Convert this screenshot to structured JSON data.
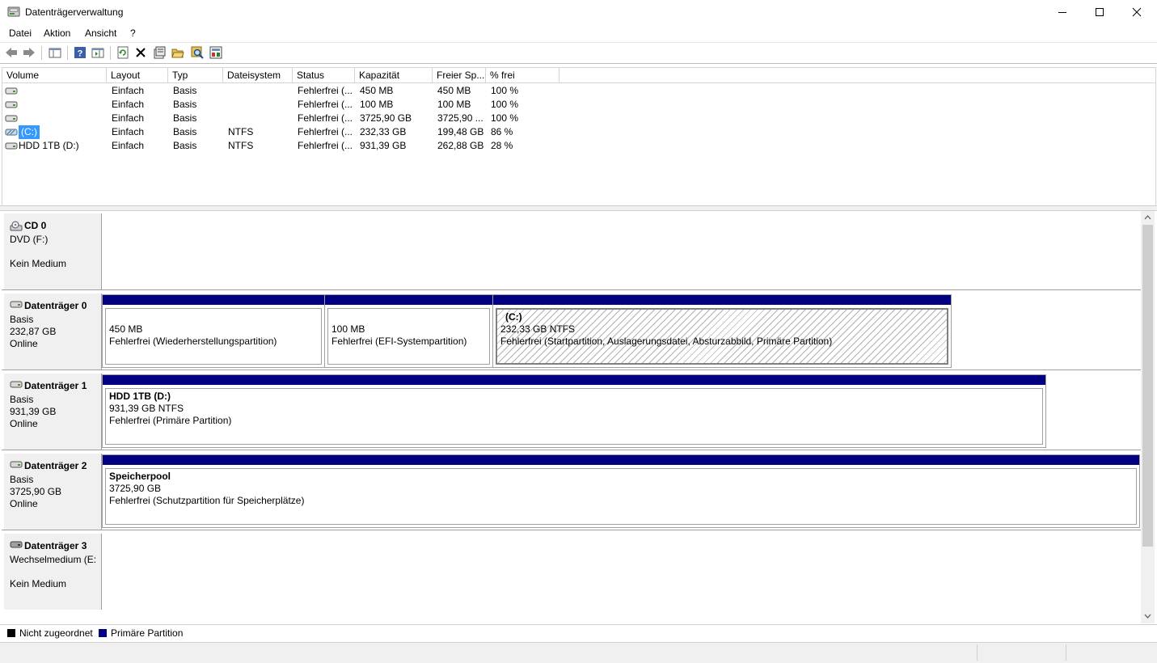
{
  "window": {
    "title": "Datenträgerverwaltung",
    "minimize_glyph": "—",
    "maximize_glyph": "☐",
    "close_glyph": "✕"
  },
  "menu": [
    "Datei",
    "Aktion",
    "Ansicht",
    "?"
  ],
  "toolbar": [
    "back-icon",
    "forward-icon",
    "show-hide-tree-icon",
    "help-icon",
    "show-hide-action-pane-icon",
    "refresh-icon",
    "delete-icon",
    "properties-icon",
    "open-icon",
    "explore-icon",
    "settings-icon"
  ],
  "volume_list": {
    "columns": [
      "Volume",
      "Layout",
      "Typ",
      "Dateisystem",
      "Status",
      "Kapazität",
      "Freier Sp...",
      "% frei"
    ],
    "rows": [
      {
        "volume": "",
        "layout": "Einfach",
        "typ": "Basis",
        "fs": "",
        "status": "Fehlerfrei (...",
        "cap": "450 MB",
        "free": "450 MB",
        "pct": "100 %"
      },
      {
        "volume": "",
        "layout": "Einfach",
        "typ": "Basis",
        "fs": "",
        "status": "Fehlerfrei (...",
        "cap": "100 MB",
        "free": "100 MB",
        "pct": "100 %"
      },
      {
        "volume": "",
        "layout": "Einfach",
        "typ": "Basis",
        "fs": "",
        "status": "Fehlerfrei (...",
        "cap": "3725,90 GB",
        "free": "3725,90 ...",
        "pct": "100 %"
      },
      {
        "volume": "(C:)",
        "layout": "Einfach",
        "typ": "Basis",
        "fs": "NTFS",
        "status": "Fehlerfrei (...",
        "cap": "232,33 GB",
        "free": "199,48 GB",
        "pct": "86 %"
      },
      {
        "volume": "HDD 1TB (D:)",
        "layout": "Einfach",
        "typ": "Basis",
        "fs": "NTFS",
        "status": "Fehlerfrei (...",
        "cap": "931,39 GB",
        "free": "262,88 GB",
        "pct": "28 %"
      }
    ]
  },
  "disks": {
    "cd0": {
      "name": "CD 0",
      "l1": "DVD (F:)",
      "l2": "",
      "l3": "Kein Medium"
    },
    "disk0": {
      "name": "Datenträger 0",
      "l1": "Basis",
      "l2": "232,87 GB",
      "l3": "Online",
      "parts": [
        {
          "name": "",
          "size": "450 MB",
          "status": "Fehlerfrei (Wiederherstellungspartition)"
        },
        {
          "name": "",
          "size": "100 MB",
          "status": "Fehlerfrei (EFI-Systempartition)"
        },
        {
          "name": "(C:)",
          "size": "232,33 GB NTFS",
          "status": "Fehlerfrei (Startpartition, Auslagerungsdatei, Absturzabbild, Primäre Partition)"
        }
      ]
    },
    "disk1": {
      "name": "Datenträger 1",
      "l1": "Basis",
      "l2": "931,39 GB",
      "l3": "Online",
      "parts": [
        {
          "name": "HDD 1TB  (D:)",
          "size": "931,39 GB NTFS",
          "status": "Fehlerfrei (Primäre Partition)"
        }
      ]
    },
    "disk2": {
      "name": "Datenträger 2",
      "l1": "Basis",
      "l2": "3725,90 GB",
      "l3": "Online",
      "parts": [
        {
          "name": "Speicherpool",
          "size": "3725,90 GB",
          "status": "Fehlerfrei (Schutzpartition für Speicherplätze)"
        }
      ]
    },
    "disk3": {
      "name": "Datenträger 3",
      "l1": "Wechselmedium (E:",
      "l2": "",
      "l3": "Kein Medium"
    }
  },
  "legend": [
    {
      "label": "Nicht zugeordnet",
      "color": "#000000"
    },
    {
      "label": "Primäre Partition",
      "color": "#000080"
    }
  ],
  "colors": {
    "primary_partition": "#000080",
    "selection": "#3399ff"
  }
}
